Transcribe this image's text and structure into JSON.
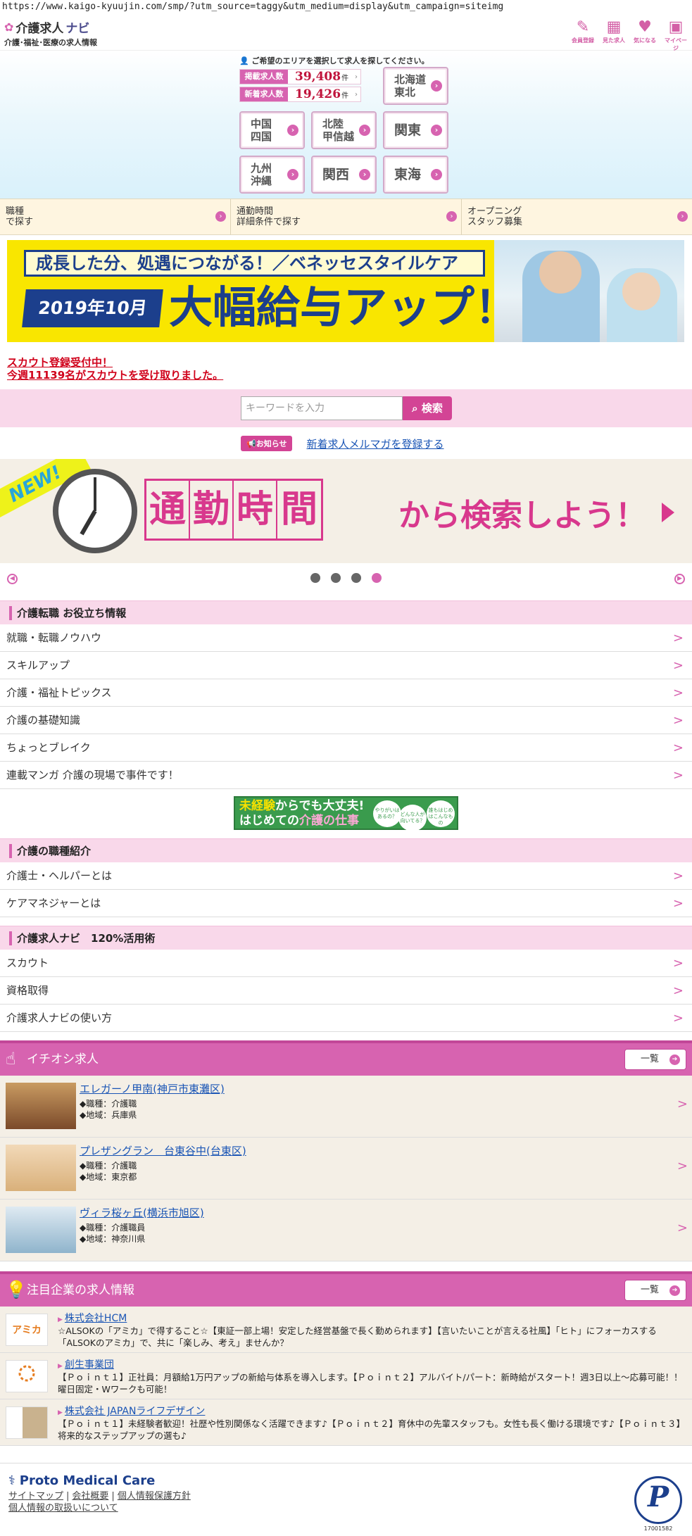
{
  "browser": {
    "url": "https://www.kaigo-kyuujin.com/smp/?utm_source=taggy&utm_medium=display&utm_campaign=siteimg"
  },
  "header": {
    "logo_title": "介護求人",
    "logo_navi": "ナビ",
    "logo_subtitle": "介護･福祉･医療の求人情報",
    "icons": [
      {
        "label": "会員登録",
        "icon": "pencil-icon"
      },
      {
        "label": "見た求人",
        "icon": "calendar-icon"
      },
      {
        "label": "気になる",
        "icon": "heart-icon"
      },
      {
        "label": "マイページ",
        "icon": "mypage-icon"
      }
    ]
  },
  "area": {
    "hint": "ご希望のエリアを選択して求人を探してください。",
    "posted_label": "掲載求人数",
    "posted_value": "39,408",
    "new_label": "新着求人数",
    "new_value": "19,426",
    "unit": "件",
    "regions": [
      {
        "label": "北海道\n東北"
      },
      {
        "label": "中国\n四国"
      },
      {
        "label": "北陸\n甲信越"
      },
      {
        "label": "関東"
      },
      {
        "label": "九州\n沖縄"
      },
      {
        "label": "関西"
      },
      {
        "label": "東海"
      }
    ]
  },
  "search_row": [
    {
      "label": "職種\nで探す"
    },
    {
      "label": "通勤時間\n詳細条件で探す"
    },
    {
      "label": "オープニング\nスタッフ募集"
    }
  ],
  "banner1": {
    "top": "成長した分、処遇につながる！／ベネッセスタイルケア",
    "year": "2019年10月",
    "big": "大幅給与アップ！"
  },
  "scout": {
    "line1": "スカウト登録受付中！",
    "line2": "今週11139名がスカウトを受け取りました。"
  },
  "search": {
    "placeholder": "キーワードを入力",
    "button": "検索"
  },
  "notice": {
    "badge": "お知らせ",
    "link": "新着求人メルマガを登録する"
  },
  "banner2": {
    "new": "NEW!",
    "kanji": [
      "通",
      "勤",
      "時",
      "間"
    ],
    "rest": "から検索しよう！"
  },
  "carousel": {
    "count": 4,
    "active": 3
  },
  "sections": [
    {
      "title": "介護転職 お役立ち情報",
      "items": [
        "就職・転職ノウハウ",
        "スキルアップ",
        "介護・福祉トピックス",
        "介護の基礎知識",
        "ちょっとブレイク",
        "連載マンガ 介護の現場で事件です！"
      ]
    },
    {
      "title": "介護の職種紹介",
      "items": [
        "介護士・ヘルパーとは",
        "ケアマネジャーとは"
      ]
    },
    {
      "title": "介護求人ナビ　120%活用術",
      "items": [
        "スカウト",
        "資格取得",
        "介護求人ナビの使い方"
      ]
    }
  ],
  "mini_banner": {
    "a1": "未経験",
    "a2": "からでも大丈夫!",
    "b1": "はじめての",
    "b2": "介護の仕事",
    "bubble1": "やりがいはあるの？",
    "bubble2": "どんな人が向いてる？",
    "bubble3": "誰もはじめはこんなもの"
  },
  "featured": {
    "title": "イチオシ求人",
    "list_label": "一覧",
    "jobs": [
      {
        "name": "エレガーノ甲南(神戸市東灘区)",
        "desc": "◆職種：介護職\n◆地域：兵庫県"
      },
      {
        "name": "プレザングラン　台東谷中(台東区)",
        "desc": "◆職種：介護職\n◆地域：東京都"
      },
      {
        "name": "ヴィラ桜ヶ丘(横浜市旭区)",
        "desc": "◆職種：介護職員\n◆地域：神奈川県"
      }
    ]
  },
  "companies": {
    "title": "注目企業の求人情報",
    "list_label": "一覧",
    "items": [
      {
        "name": "株式会社HCM",
        "desc": "☆ALSOKの「アミカ」で得すること☆【東証一部上場！安定した経営基盤で長く勤められます】【言いたいことが言える社風】「ヒト」にフォーカスする「ALSOKのアミカ」で、共に「楽しみ、考え」ませんか？",
        "logo_text": "アミカ"
      },
      {
        "name": "創生事業団",
        "desc": "【Ｐｏｉｎｔ１】正社員：月額給1万円アップの新給与体系を導入します。【Ｐｏｉｎｔ２】アルバイト/パート：新時給がスタート！週3日以上〜応募可能！！曜日固定・Wワークも可能！",
        "logo_text": ""
      },
      {
        "name": "株式会社 JAPANライフデザイン",
        "desc": "【Ｐｏｉｎｔ１】未経験者歓迎！社歴や性別関係なく活躍できます♪【Ｐｏｉｎｔ２】育休中の先輩スタッフも。女性も長く働ける環境です♪【Ｐｏｉｎｔ３】将来的なステップアップの選も♪",
        "logo_text": ""
      }
    ]
  },
  "footer": {
    "brand": "Proto Medical Care",
    "links": [
      "サイトマップ",
      "会社概要",
      "個人情報保護方針",
      "個人情報の取扱いについて"
    ],
    "privacy_mark": "P",
    "privacy_number": "17001582"
  },
  "colors": {
    "accent": "#d763b0",
    "accent_dark": "#c24798",
    "pink_bg": "#f9d8ea",
    "beige": "#f4efe6",
    "navy": "#1c3f8c"
  }
}
